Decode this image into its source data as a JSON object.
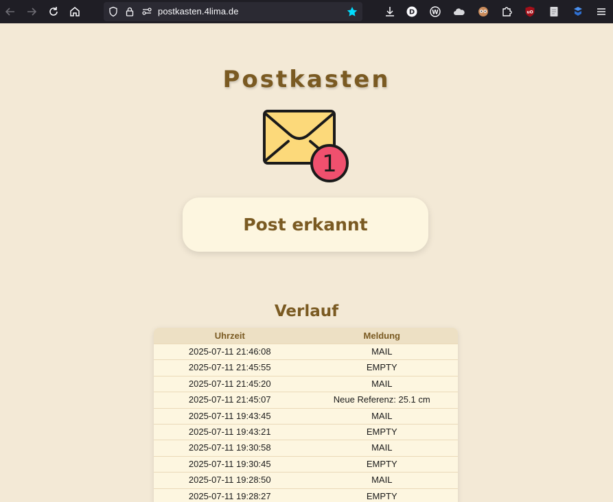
{
  "browser": {
    "url": "postkasten.4lima.de"
  },
  "page": {
    "title": "Postkasten",
    "badge_count": "1",
    "status": "Post erkannt",
    "history_title": "Verlauf"
  },
  "table": {
    "headers": [
      "Uhrzeit",
      "Meldung"
    ],
    "rows": [
      [
        "2025-07-11 21:46:08",
        "MAIL"
      ],
      [
        "2025-07-11 21:45:55",
        "EMPTY"
      ],
      [
        "2025-07-11 21:45:20",
        "MAIL"
      ],
      [
        "2025-07-11 21:45:07",
        "Neue Referenz: 25.1 cm"
      ],
      [
        "2025-07-11 19:43:45",
        "MAIL"
      ],
      [
        "2025-07-11 19:43:21",
        "EMPTY"
      ],
      [
        "2025-07-11 19:30:58",
        "MAIL"
      ],
      [
        "2025-07-11 19:30:45",
        "EMPTY"
      ],
      [
        "2025-07-11 19:28:50",
        "MAIL"
      ],
      [
        "2025-07-11 19:28:27",
        "EMPTY"
      ]
    ]
  },
  "colors": {
    "background": "#f3e9d6",
    "accent_brown": "#7a5a22",
    "card": "#fdf6e0",
    "badge": "#f0506e",
    "envelope": "#fcd97a",
    "bookmark_star": "#00ddff"
  }
}
